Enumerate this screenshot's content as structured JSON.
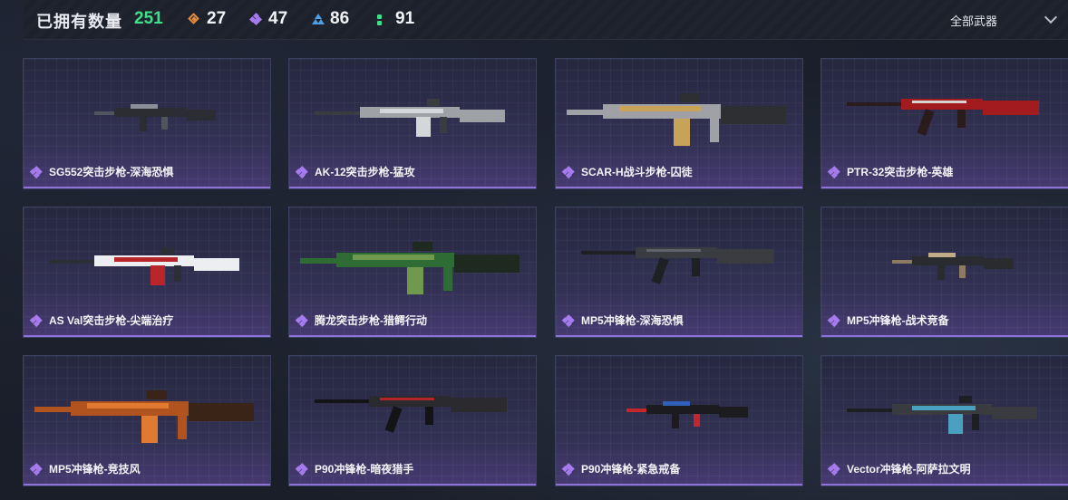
{
  "header": {
    "owned_label": "已拥有数量",
    "owned_total": "251",
    "stats": [
      {
        "icon": "orange-rarity-icon",
        "value": "27",
        "color": "#e08a3a"
      },
      {
        "icon": "purple-rarity-icon",
        "value": "47",
        "color": "#a67bf0"
      },
      {
        "icon": "blue-rarity-icon",
        "value": "86",
        "color": "#4ba0e6"
      },
      {
        "icon": "green-rarity-icon",
        "value": "91",
        "color": "#3fe08a"
      }
    ],
    "filter_label": "全部武器"
  },
  "weapons": [
    {
      "name": "SG552突击步枪-深海恐惧",
      "rarity": "purple",
      "skin_colors": [
        "#2b2d33",
        "#50545c",
        "#8a8f98"
      ]
    },
    {
      "name": "AK-12突击步枪-猛攻",
      "rarity": "purple",
      "skin_colors": [
        "#3a3c41",
        "#9ea1a6",
        "#d5d6d9"
      ]
    },
    {
      "name": "SCAR-H战斗步枪-囚徒",
      "rarity": "purple",
      "skin_colors": [
        "#2e2f33",
        "#a0a1a6",
        "#c7a35a"
      ]
    },
    {
      "name": "PTR-32突击步枪-英雄",
      "rarity": "purple",
      "skin_colors": [
        "#2a1b1c",
        "#a21c1f",
        "#d8d4cf"
      ]
    },
    {
      "name": "AS Val突击步枪-尖端治疗",
      "rarity": "purple",
      "skin_colors": [
        "#2d2f36",
        "#eceef2",
        "#b8262c"
      ]
    },
    {
      "name": "腾龙突击步枪-猎鳄行动",
      "rarity": "purple",
      "skin_colors": [
        "#1e2a1f",
        "#2f6b34",
        "#6f9a4e"
      ]
    },
    {
      "name": "MP5冲锋枪-深海恐惧",
      "rarity": "purple",
      "skin_colors": [
        "#1f2024",
        "#3a3c42",
        "#5e626b"
      ]
    },
    {
      "name": "MP5冲锋枪-战术竞备",
      "rarity": "purple",
      "skin_colors": [
        "#2a2b2f",
        "#8e7a62",
        "#c2ab88"
      ]
    },
    {
      "name": "MP5冲锋枪-竞技风",
      "rarity": "purple",
      "skin_colors": [
        "#3a2418",
        "#b0531f",
        "#e07a30"
      ]
    },
    {
      "name": "P90冲锋枪-暗夜猎手",
      "rarity": "purple",
      "skin_colors": [
        "#141417",
        "#2a2a2f",
        "#b4252a"
      ]
    },
    {
      "name": "P90冲锋枪-紧急戒备",
      "rarity": "purple",
      "skin_colors": [
        "#1c1c20",
        "#c5262a",
        "#2f5fb8"
      ]
    },
    {
      "name": "Vector冲锋枪-阿萨拉文明",
      "rarity": "purple",
      "skin_colors": [
        "#1e1f22",
        "#3a3b40",
        "#4aa0c0"
      ]
    }
  ]
}
